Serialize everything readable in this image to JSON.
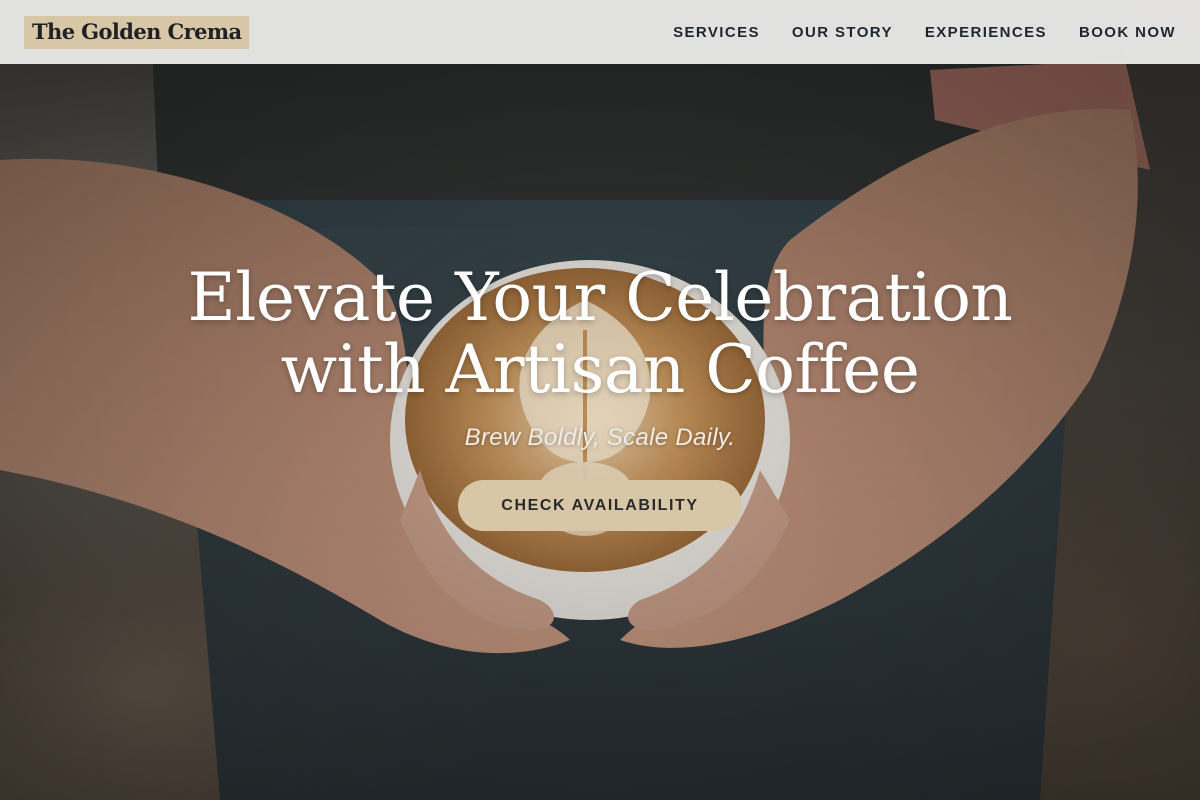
{
  "site": {
    "logo_text": "The Golden Crema"
  },
  "nav": {
    "items": [
      {
        "label": "SERVICES"
      },
      {
        "label": "OUR STORY"
      },
      {
        "label": "EXPERIENCES"
      },
      {
        "label": "BOOK NOW"
      }
    ]
  },
  "hero": {
    "title_line1": "Elevate Your Celebration",
    "title_line2": "with Artisan Coffee",
    "tagline": "Brew Boldly, Scale Daily.",
    "cta_label": "CHECK AVAILABILITY",
    "background_image": "hands holding a latte art coffee cup"
  },
  "colors": {
    "accent": "#d8c7a6",
    "nav_text": "#1e2731",
    "nav_background": "#f0f0ee",
    "hero_text": "#ffffff"
  }
}
